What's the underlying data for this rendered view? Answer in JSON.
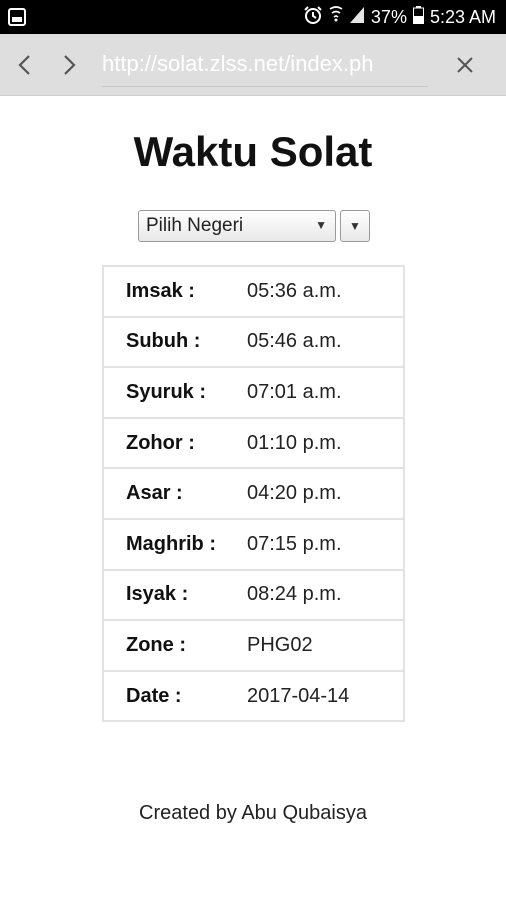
{
  "status_bar": {
    "battery_percent": "37%",
    "time": "5:23 AM",
    "icons": [
      "gallery-icon",
      "alarm-icon",
      "wifi-icon",
      "signal-icon",
      "battery-icon"
    ]
  },
  "browser": {
    "url": "http://solat.zlss.net/index.ph",
    "icons": [
      "back-arrow-icon",
      "forward-arrow-icon",
      "close-icon"
    ]
  },
  "page": {
    "title": "Waktu Solat",
    "state_select": {
      "selected": "Pilih Negeri"
    },
    "rows": [
      {
        "label": "Imsak :",
        "value": "05:36 a.m."
      },
      {
        "label": "Subuh :",
        "value": "05:46 a.m."
      },
      {
        "label": "Syuruk :",
        "value": "07:01 a.m."
      },
      {
        "label": "Zohor :",
        "value": "01:10 p.m."
      },
      {
        "label": "Asar :",
        "value": "04:20 p.m."
      },
      {
        "label": "Maghrib :",
        "value": "07:15 p.m."
      },
      {
        "label": "Isyak :",
        "value": "08:24 p.m."
      },
      {
        "label": "Zone :",
        "value": "PHG02"
      },
      {
        "label": "Date :",
        "value": "2017-04-14"
      }
    ],
    "footer": "Created by Abu Qubaisya"
  }
}
